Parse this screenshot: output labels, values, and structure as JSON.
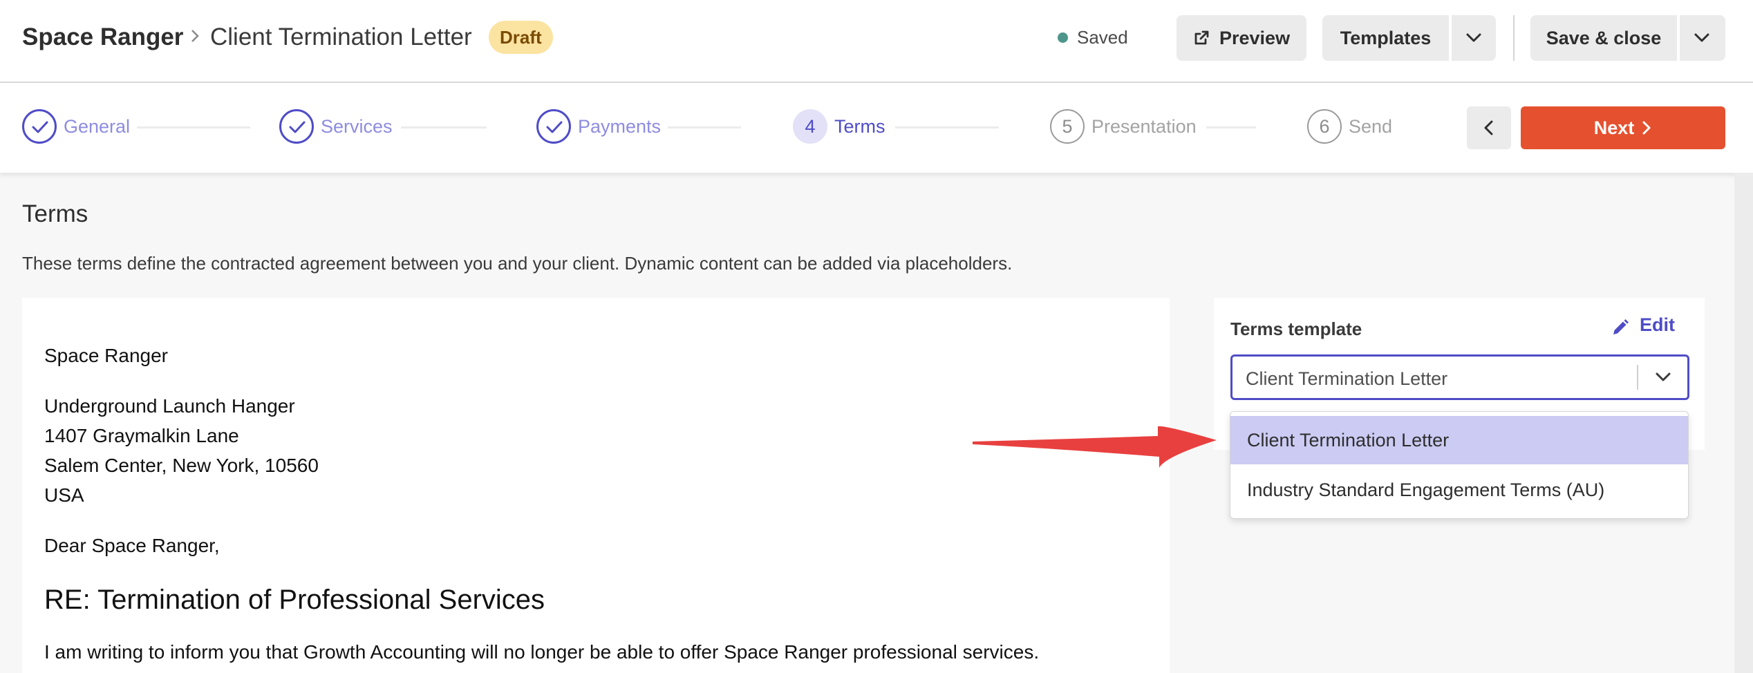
{
  "header": {
    "breadcrumb_root": "Space Ranger",
    "document_title": "Client Termination Letter",
    "status_badge": "Draft",
    "save_status": "Saved",
    "preview_label": "Preview",
    "templates_label": "Templates",
    "save_close_label": "Save & close"
  },
  "stepper": {
    "steps": [
      {
        "label": "General",
        "state": "done"
      },
      {
        "label": "Services",
        "state": "done"
      },
      {
        "label": "Payments",
        "state": "done"
      },
      {
        "number": "4",
        "label": "Terms",
        "state": "active"
      },
      {
        "number": "5",
        "label": "Presentation",
        "state": "todo"
      },
      {
        "number": "6",
        "label": "Send",
        "state": "todo"
      }
    ],
    "next_label": "Next"
  },
  "section": {
    "title": "Terms",
    "description": "These terms define the contracted agreement between you and your client. Dynamic content can be added via placeholders."
  },
  "letter": {
    "client_name": "Space Ranger",
    "address_lines": [
      "Underground Launch Hanger",
      "1407 Graymalkin Lane",
      "Salem Center, New York, 10560",
      "USA"
    ],
    "salutation": "Dear Space Ranger,",
    "heading": "RE: Termination of Professional Services",
    "body": "I am writing to inform you that Growth Accounting will no longer be able to offer Space Ranger professional services."
  },
  "terms_panel": {
    "label": "Terms template",
    "edit_label": "Edit",
    "selected_value": "Client Termination Letter",
    "options": [
      "Client Termination Letter",
      "Industry Standard Engagement Terms (AU)"
    ]
  },
  "colors": {
    "accent": "#4f4cc7",
    "next_button": "#e5512f",
    "draft_badge": "#fbe3a1",
    "annotation_arrow": "#e8403f"
  }
}
